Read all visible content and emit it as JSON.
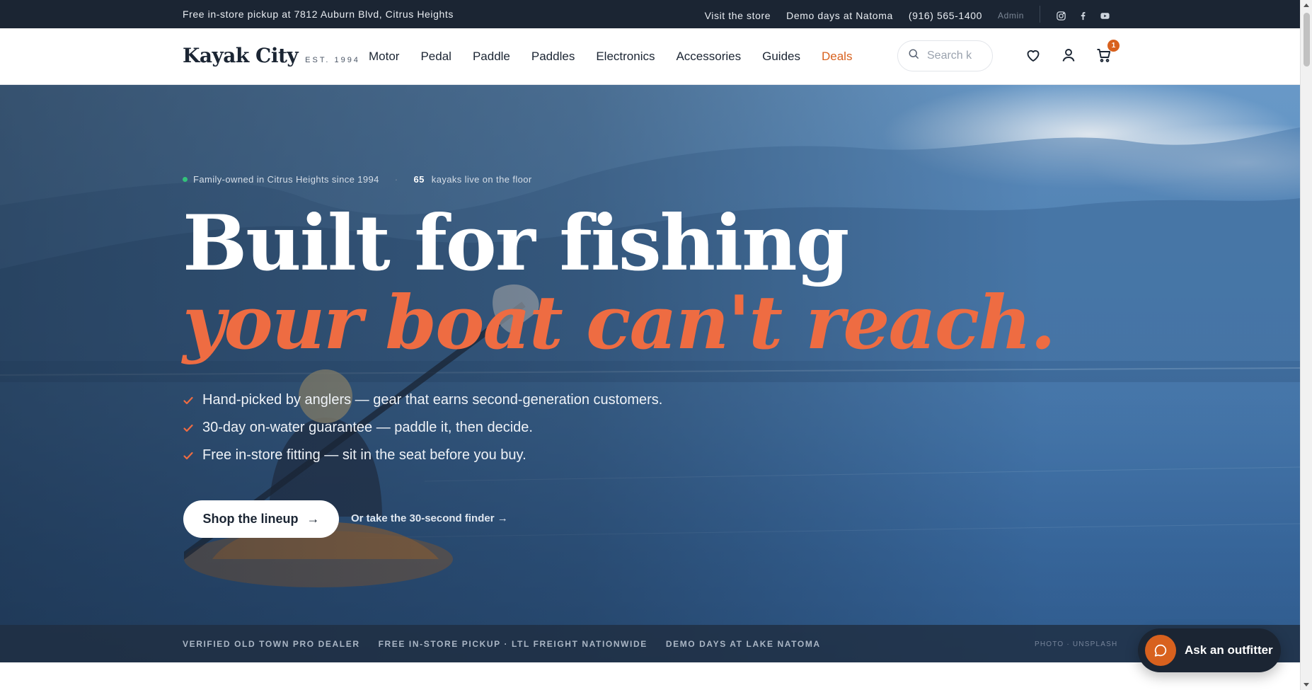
{
  "topbar": {
    "pickup": "Free in-store pickup at 7812 Auburn Blvd, Citrus Heights",
    "links": [
      "Visit the store",
      "Demo days at Natoma",
      "(916) 565-1400"
    ],
    "admin": "Admin",
    "social": [
      "instagram-icon",
      "facebook-icon",
      "youtube-icon"
    ]
  },
  "header": {
    "logo_name": "Kayak City",
    "logo_est": "EST. 1994",
    "nav": [
      "Motor",
      "Pedal",
      "Paddle",
      "Paddles",
      "Electronics",
      "Accessories",
      "Guides",
      "Deals"
    ],
    "search_placeholder": "Search k",
    "cart_count": "1"
  },
  "hero": {
    "meta_left": "Family-owned in Citrus Heights since 1994",
    "meta_sep": "·",
    "meta_num": "65",
    "meta_right": "kayaks live on the floor",
    "headline_1": "Built for fishing",
    "headline_2": "your boat can't reach.",
    "checks": [
      "Hand-picked by anglers — gear that earns second-generation customers.",
      "30-day on-water guarantee — paddle it, then decide.",
      "Free in-store fitting — sit in the seat before you buy."
    ],
    "cta_label": "Shop the lineup",
    "cta_arrow": "→",
    "finder_label": "Or take the 30-second finder →"
  },
  "strip": {
    "items": [
      "VERIFIED OLD TOWN PRO DEALER",
      "FREE IN-STORE PICKUP · LTL FREIGHT NATIONWIDE",
      "DEMO DAYS AT LAKE NATOMA"
    ],
    "photo_credit": "PHOTO · UNSPLASH"
  },
  "chat": {
    "label": "Ask an outfitter"
  },
  "colors": {
    "accent": "#d8611e",
    "headline_accent": "#ee6c42",
    "dark": "#1b2533",
    "check": "#ee6c42"
  }
}
